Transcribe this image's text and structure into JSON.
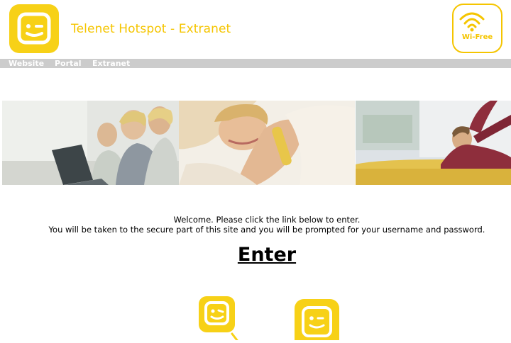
{
  "header": {
    "title": "Telenet Hotspot - Extranet",
    "logo_icon": "telenet-smiley-logo-icon",
    "badge_icon": "wifi-icon",
    "badge_label": "Wi-Free"
  },
  "nav": {
    "items": [
      {
        "label": "Website"
      },
      {
        "label": "Portal"
      },
      {
        "label": "Extranet"
      }
    ]
  },
  "photos": [
    "people-laptop-photo",
    "woman-phone-photo",
    "man-sofa-photo"
  ],
  "main": {
    "welcome_line1": "Welcome. Please click the link below to enter.",
    "welcome_line2": "You will be taken to the secure part of this site and you will be prompted for your username and password.",
    "enter_label": "Enter"
  },
  "colors": {
    "brand_yellow": "#f7d117",
    "title_yellow": "#f5c500",
    "nav_bar": "#cccccc"
  }
}
